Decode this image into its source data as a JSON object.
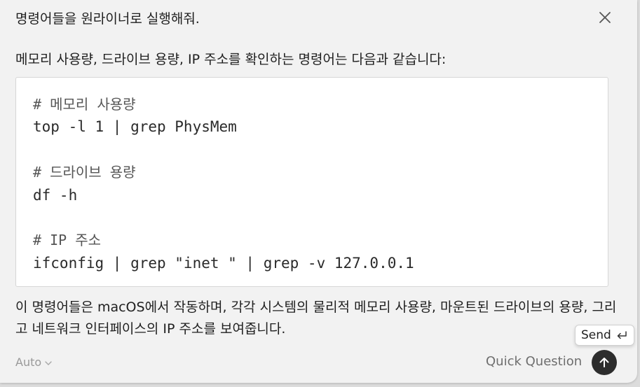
{
  "prompt": "명령어들을 원라이너로 실행해줘.",
  "response": {
    "intro": "메모리 사용량, 드라이브 용량, IP 주소를 확인하는 명령어는 다음과 같습니다:",
    "code_lines": [
      "# 메모리 사용량",
      "top -l 1 | grep PhysMem",
      "",
      "# 드라이브 용량",
      "df -h",
      "",
      "# IP 주소",
      "ifconfig | grep \"inet \" | grep -v 127.0.0.1"
    ],
    "outro": "이 명령어들은 macOS에서 작동하며, 각각 시스템의 물리적 메모리 사용량, 마운트된 드라이브의 용량, 그리고 네트워크 인터페이스의 IP 주소를 보여줍니다."
  },
  "footer": {
    "model_label": "Auto",
    "quick_question_label": "Quick Question",
    "send_tooltip": "Send"
  },
  "icons": {
    "close": "close-icon",
    "chevron": "chevron-down-icon",
    "send": "arrow-up-icon",
    "return": "return-key-icon"
  }
}
